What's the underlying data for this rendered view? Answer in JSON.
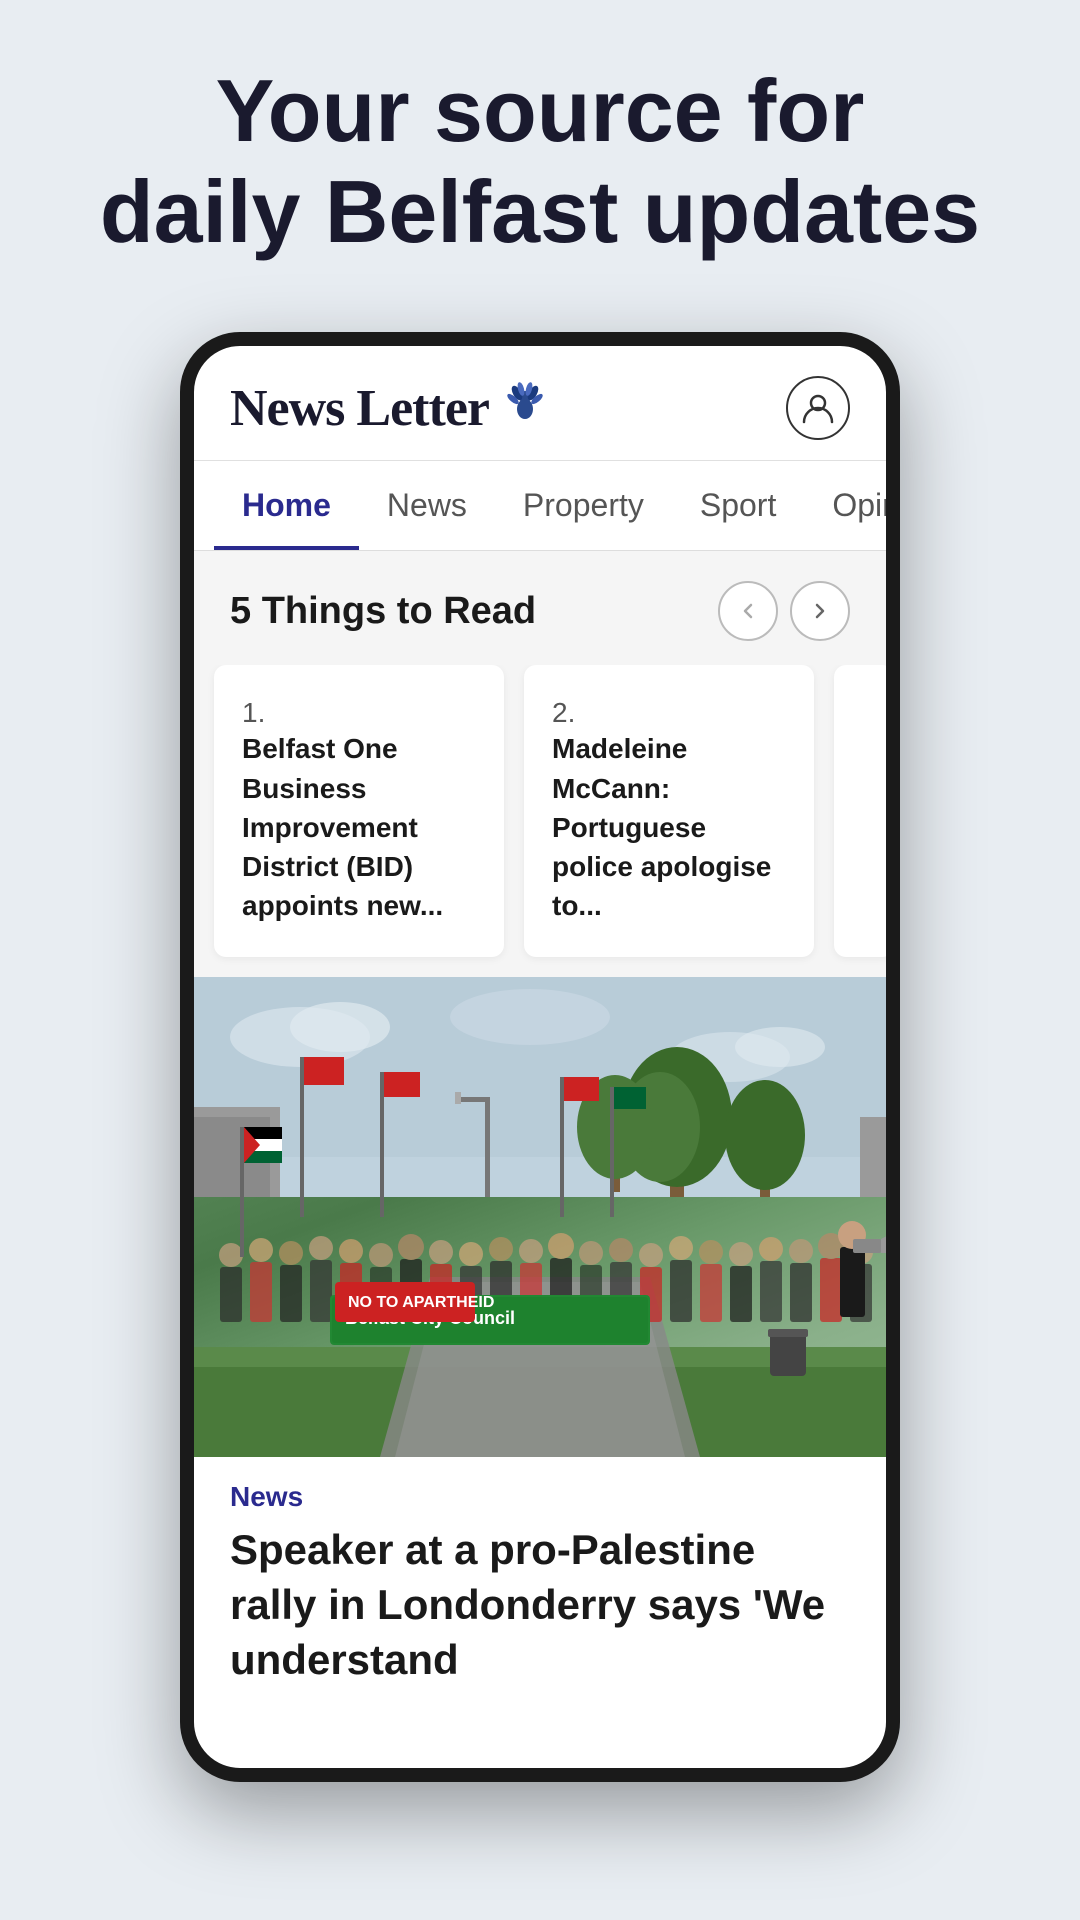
{
  "page": {
    "hero": {
      "line1": "Your source for",
      "line2": "daily Belfast updates"
    }
  },
  "app": {
    "header": {
      "logo": "News Letter",
      "peacock_emoji": "🦚",
      "user_icon_label": "User account"
    },
    "nav": {
      "tabs": [
        {
          "id": "home",
          "label": "Home",
          "active": true
        },
        {
          "id": "news",
          "label": "News",
          "active": false
        },
        {
          "id": "property",
          "label": "Property",
          "active": false
        },
        {
          "id": "sport",
          "label": "Sport",
          "active": false
        },
        {
          "id": "opinion",
          "label": "Opinion",
          "active": false
        }
      ]
    },
    "five_things": {
      "title": "5 Things to Read",
      "prev_arrow": "‹",
      "next_arrow": "›",
      "cards": [
        {
          "number": "1.",
          "text": "Belfast One Business Improvement District (BID) appoints new..."
        },
        {
          "number": "2.",
          "text": "Madeleine McCann: Portuguese police apologise to..."
        }
      ]
    },
    "main_article": {
      "category": "News",
      "headline": "Speaker at a pro-Palestine rally in Londonderry says 'We understand",
      "image_alt": "Protest rally scene with crowd holding flags and banners"
    }
  }
}
